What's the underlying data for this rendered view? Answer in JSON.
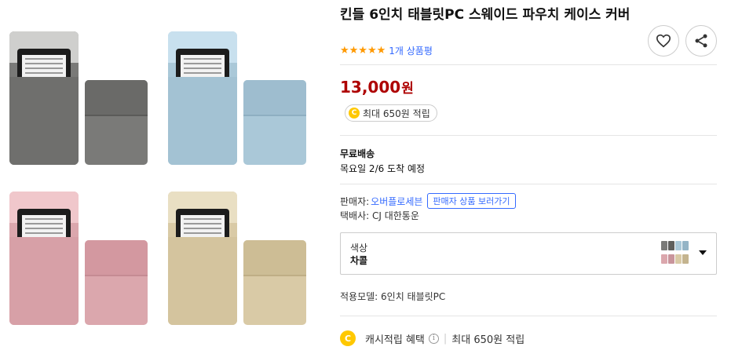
{
  "product": {
    "title": "킨들 6인치 태블릿PC 스웨이드 파우치 케이스 커버",
    "stars": "★★★★★",
    "review_count": "1개 상품평",
    "rating": 5,
    "price_value": "13,000",
    "price_unit": "원",
    "reward_chip": "최대 650원 적립"
  },
  "shipping": {
    "title": "무료배송",
    "arrival": "목요일 2/6 도착 예정"
  },
  "seller": {
    "label": "판매자:",
    "name": "오버플로세븐",
    "button": "판매자 상품 보러가기",
    "courier": "택배사: CJ 대한통운"
  },
  "option": {
    "label": "색상",
    "value": "차콜",
    "swatch_colors": [
      "#7a7a78",
      "#aac8d8",
      "#dba7ad",
      "#d9caa6"
    ]
  },
  "model": "적용모델: 6인치 태블릿PC",
  "cash": {
    "coin": "C",
    "label": "캐시적립 혜택",
    "info": "i",
    "separator": "|",
    "amount": "최대 650원 적립"
  },
  "icons": {
    "favorite": "heart-icon",
    "share": "share-icon",
    "coin_letter": "C"
  },
  "colors": {
    "price": "#ae0000",
    "link": "#346aff",
    "star": "#ff9900",
    "coin": "#ffc800"
  }
}
